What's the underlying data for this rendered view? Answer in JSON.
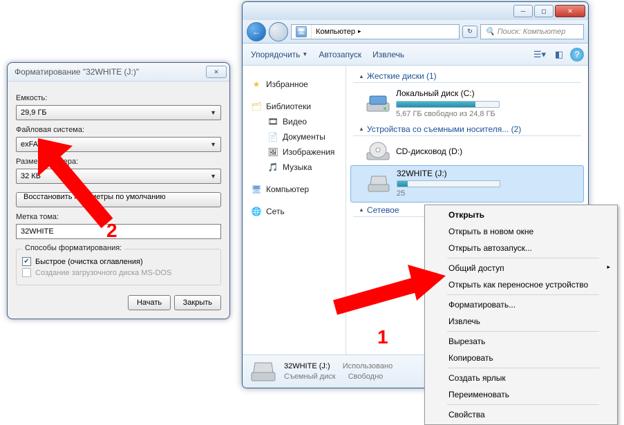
{
  "format": {
    "title": "Форматирование \"32WHITE (J:)\"",
    "capacity_label": "Емкость:",
    "capacity_value": "29,9 ГБ",
    "filesystem_label": "Файловая система:",
    "filesystem_value": "exFAT",
    "cluster_label": "Размер кластера:",
    "cluster_value": "32 КБ",
    "restore_btn": "Восстановить параметры по умолчанию",
    "volume_label": "Метка тома:",
    "volume_value": "32WHITE",
    "options_group": "Способы форматирования:",
    "quick_label": "Быстрое (очистка оглавления)",
    "msdos_label": "Создание загрузочного диска MS-DOS",
    "start_btn": "Начать",
    "close_btn": "Закрыть"
  },
  "explorer": {
    "breadcrumb_seg": "Компьютер",
    "search_placeholder": "Поиск: Компьютер",
    "toolbar": {
      "organize": "Упорядочить",
      "autoplay": "Автозапуск",
      "eject": "Извлечь"
    },
    "tree": {
      "favorites": "Избранное",
      "libraries": "Библиотеки",
      "video": "Видео",
      "documents": "Документы",
      "images": "Изображения",
      "music": "Музыка",
      "computer": "Компьютер",
      "network": "Сеть"
    },
    "groups": {
      "hdd": "Жесткие диски (1)",
      "removable": "Устройства со съемными носителя... (2)",
      "netloc": "Сетевое"
    },
    "drives": {
      "c": {
        "name": "Локальный диск (C:)",
        "sub": "5,67 ГБ свободно из 24,8 ГБ",
        "fill_pct": 77
      },
      "d": {
        "name": "CD-дисковод (D:)"
      },
      "j": {
        "name": "32WHITE (J:)",
        "sub": "25",
        "fill_pct": 10
      }
    },
    "status": {
      "title": "32WHITE (J:)",
      "type": "Съемный диск",
      "used_label": "Использовано",
      "free_label": "Свободно"
    }
  },
  "context_menu": {
    "open": "Открыть",
    "open_new": "Открыть в новом окне",
    "open_autorun": "Открыть автозапуск...",
    "share": "Общий доступ",
    "portable": "Открыть как переносное устройство",
    "format": "Форматировать...",
    "eject": "Извлечь",
    "cut": "Вырезать",
    "copy": "Копировать",
    "shortcut": "Создать ярлык",
    "rename": "Переименовать",
    "properties": "Свойства"
  },
  "annotations": {
    "one": "1",
    "two": "2"
  }
}
